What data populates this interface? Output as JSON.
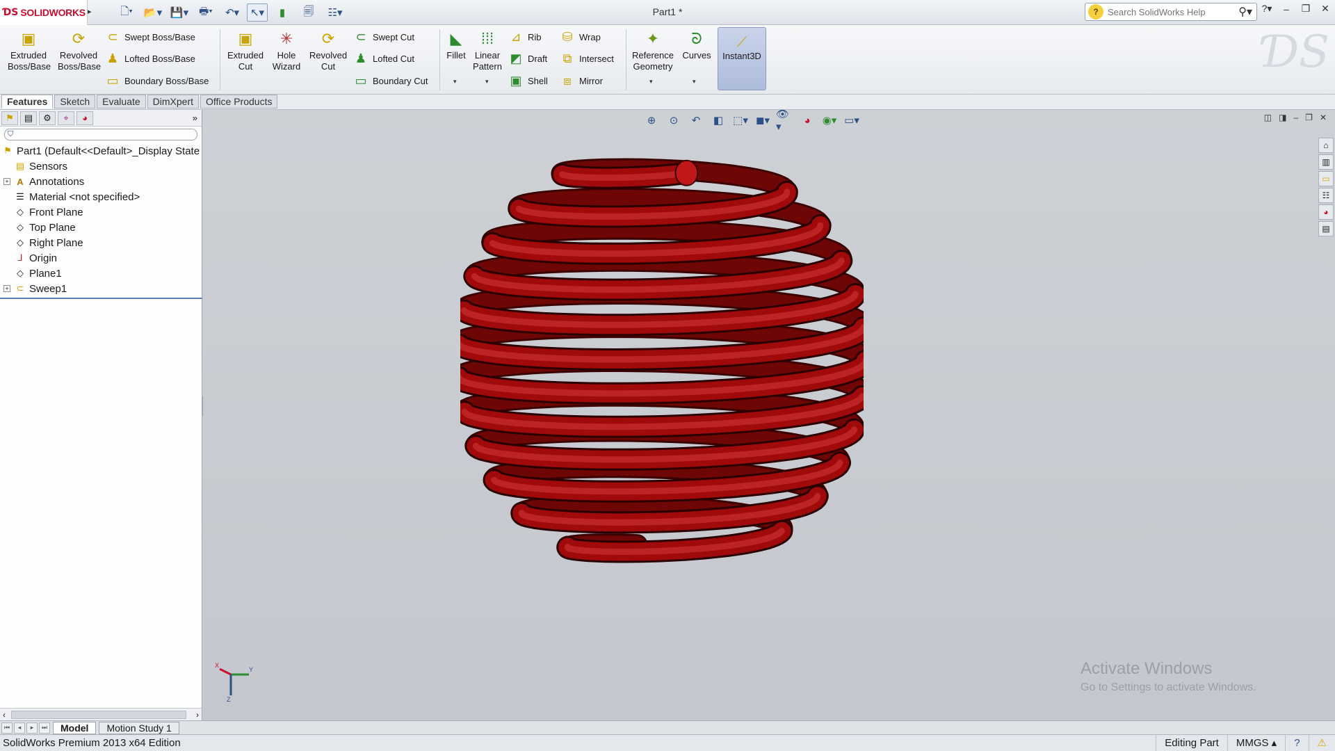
{
  "app": {
    "brand": "SOLIDWORKS",
    "doc_title": "Part1 *",
    "help_search_placeholder": "Search SolidWorks Help"
  },
  "ribbon": {
    "extruded_boss": "Extruded Boss/Base",
    "revolved_boss": "Revolved Boss/Base",
    "swept_boss": "Swept Boss/Base",
    "lofted_boss": "Lofted Boss/Base",
    "boundary_boss": "Boundary Boss/Base",
    "extruded_cut": "Extruded Cut",
    "hole_wizard": "Hole Wizard",
    "revolved_cut": "Revolved Cut",
    "swept_cut": "Swept Cut",
    "lofted_cut": "Lofted Cut",
    "boundary_cut": "Boundary Cut",
    "fillet": "Fillet",
    "linear_pattern": "Linear Pattern",
    "rib": "Rib",
    "draft": "Draft",
    "shell": "Shell",
    "wrap": "Wrap",
    "intersect": "Intersect",
    "mirror": "Mirror",
    "reference_geometry": "Reference Geometry",
    "curves": "Curves",
    "instant3d": "Instant3D"
  },
  "command_tabs": [
    "Features",
    "Sketch",
    "Evaluate",
    "DimXpert",
    "Office Products"
  ],
  "tree": {
    "root": "Part1  (Default<<Default>_Display State",
    "items": [
      "Sensors",
      "Annotations",
      "Material <not specified>",
      "Front Plane",
      "Top Plane",
      "Right Plane",
      "Origin",
      "Plane1",
      "Sweep1"
    ]
  },
  "viewport": {
    "activate_title": "Activate Windows",
    "activate_sub": "Go to Settings to activate Windows.",
    "model_color": "#a00a0a",
    "triad": {
      "x": "X",
      "y": "Y",
      "z": "Z"
    }
  },
  "bottom_tabs": [
    "Model",
    "Motion Study 1"
  ],
  "status": {
    "edition": "SolidWorks Premium 2013 x64 Edition",
    "mode": "Editing Part",
    "units": "MMGS"
  }
}
